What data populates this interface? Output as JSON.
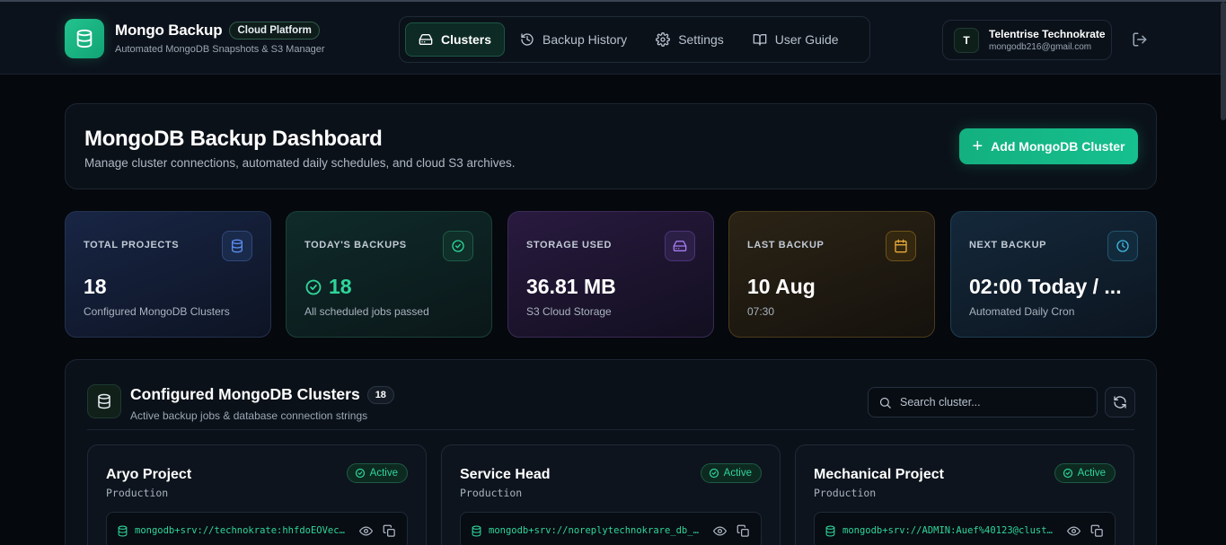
{
  "app": {
    "title": "Mongo Backup",
    "badge": "Cloud Platform",
    "subtitle": "Automated MongoDB Snapshots & S3 Manager"
  },
  "nav": {
    "items": [
      {
        "label": "Clusters",
        "icon": "hard-drive-icon",
        "active": true
      },
      {
        "label": "Backup History",
        "icon": "history-icon",
        "active": false
      },
      {
        "label": "Settings",
        "icon": "gear-icon",
        "active": false
      },
      {
        "label": "User Guide",
        "icon": "book-icon",
        "active": false
      }
    ]
  },
  "user": {
    "initial": "T",
    "name": "Telentrise Technokrate",
    "email": "mongodb216@gmail.com"
  },
  "hero": {
    "title": "MongoDB Backup Dashboard",
    "subtitle": "Manage cluster connections, automated daily schedules, and cloud S3 archives.",
    "add_button": "Add MongoDB Cluster"
  },
  "stats": [
    {
      "label": "TOTAL PROJECTS",
      "value": "18",
      "desc": "Configured MongoDB Clusters",
      "icon": "database-icon",
      "color": "#5b8def"
    },
    {
      "label": "TODAY'S BACKUPS",
      "value": "18",
      "desc": "All scheduled jobs passed",
      "icon": "check-circle-icon",
      "color": "#2fd59a"
    },
    {
      "label": "STORAGE USED",
      "value": "36.81 MB",
      "desc": "S3 Cloud Storage",
      "icon": "hard-drive-icon",
      "color": "#a77bef"
    },
    {
      "label": "LAST BACKUP",
      "value": "10 Aug",
      "desc": "07:30",
      "icon": "calendar-icon",
      "color": "#e5a93a"
    },
    {
      "label": "NEXT BACKUP",
      "value": "02:00 Today / ...",
      "desc": "Automated Daily Cron",
      "icon": "clock-icon",
      "color": "#3fb8e0"
    }
  ],
  "clusters_panel": {
    "title": "Configured MongoDB Clusters",
    "count": "18",
    "subtitle": "Active backup jobs & database connection strings",
    "search_placeholder": "Search cluster..."
  },
  "clusters": [
    {
      "name": "Aryo Project",
      "env": "Production",
      "status": "Active",
      "conn": "mongodb+srv://technokrate:hhfdoEOVec@c…"
    },
    {
      "name": "Service Head",
      "env": "Production",
      "status": "Active",
      "conn": "mongodb+srv://noreplytechnokrare_db_us…"
    },
    {
      "name": "Mechanical Project",
      "env": "Production",
      "status": "Active",
      "conn": "mongodb+srv://ADMIN:Auef%40123@cluster…"
    }
  ],
  "colors": {
    "accent": "#16c08f",
    "background": "#05080d",
    "card": "#0b1119"
  }
}
